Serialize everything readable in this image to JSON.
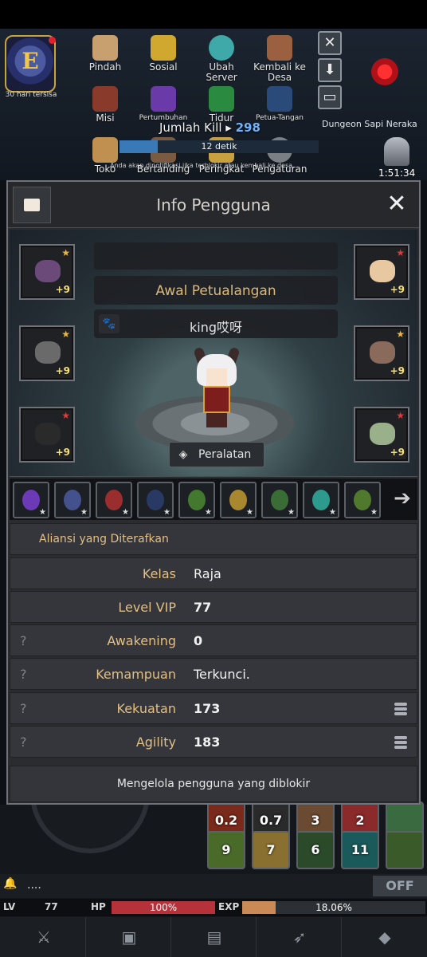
{
  "hud": {
    "guild_days": "30 hari tersisa",
    "guild_letter": "E",
    "menu": [
      {
        "label": "Pindah"
      },
      {
        "label": "Sosial"
      },
      {
        "label": "Ubah Server"
      },
      {
        "label": "Kembali ke Desa"
      },
      {
        "label": "Misi"
      },
      {
        "label": "Pertumbuhan"
      },
      {
        "label": "Tidur"
      },
      {
        "label": "Petua-Tangan"
      },
      {
        "label": "Toko"
      },
      {
        "label": "Bertanding"
      },
      {
        "label": "Peringkat"
      },
      {
        "label": "Pengaturan"
      }
    ],
    "kill_label": "Jumlah Kill",
    "kill_count": "298",
    "timer": "12 detik",
    "timer_progress": 0.19,
    "notice": "Anda akan dinotifikasi jika terblokir atau kembali ke desa.",
    "dungeon": "Dungeon Sapi Neraka",
    "clock": "1:51:34",
    "side_buttons": [
      "close-icon",
      "download-icon",
      "inbox-icon"
    ]
  },
  "modal": {
    "title": "Info Pengguna",
    "close_glyph": "✕",
    "player": {
      "title": "Awal Petualangan",
      "name": "king哎呀"
    },
    "equipment_button": "Peralatan",
    "equipment": {
      "left": [
        {
          "item": "shuriken-icon",
          "plus": "+9",
          "star_color": "#e6b84a",
          "color": "#6b4a7a"
        },
        {
          "item": "stone-icon",
          "plus": "+9",
          "star_color": "#e6b84a",
          "color": "#6a6a6a"
        },
        {
          "item": "dark-orb-icon",
          "plus": "+9",
          "star_color": "#d24040",
          "color": "#2a2a2a"
        }
      ],
      "right": [
        {
          "item": "bread-icon",
          "plus": "+9",
          "star_color": "#d24040",
          "color": "#e8c8a0"
        },
        {
          "item": "whetstone-icon",
          "plus": "+9",
          "star_color": "#e6b84a",
          "color": "#8a6a5a"
        },
        {
          "item": "ring-icon",
          "plus": "+9",
          "star_color": "#d24040",
          "color": "#9ab08a"
        }
      ]
    },
    "skills": [
      {
        "name": "shadow-strike-skill",
        "color": "#7a3fd0"
      },
      {
        "name": "shield-crest-skill",
        "color": "#4a5aa0"
      },
      {
        "name": "blood-heal-skill",
        "color": "#b03030"
      },
      {
        "name": "moonlight-skill",
        "color": "#2a3f70"
      },
      {
        "name": "nature-staff-skill",
        "color": "#4a8a30"
      },
      {
        "name": "golden-orb-skill",
        "color": "#c29a30"
      },
      {
        "name": "leaf-ring-skill",
        "color": "#3f7a3a"
      },
      {
        "name": "spirit-arrow-skill",
        "color": "#2fb0a0"
      },
      {
        "name": "stag-antler-skill",
        "color": "#5a8a30"
      }
    ],
    "alliance_label": "Aliansi yang Diterafkan",
    "stats": [
      {
        "key": "Kelas",
        "value": "Raja",
        "help": false,
        "detail": false,
        "bold": false
      },
      {
        "key": "Level VIP",
        "value": "77",
        "help": false,
        "detail": false,
        "bold": true
      },
      {
        "key": "Awakening",
        "value": "0",
        "help": true,
        "detail": false,
        "bold": true
      },
      {
        "key": "Kemampuan",
        "value": "Terkunci.",
        "help": true,
        "detail": false,
        "bold": false
      },
      {
        "key": "Kekuatan",
        "value": "173",
        "help": true,
        "detail": true,
        "bold": true
      },
      {
        "key": "Agility",
        "value": "183",
        "help": true,
        "detail": true,
        "bold": true
      }
    ],
    "help_glyph": "?",
    "blocked_button": "Mengelola pengguna yang diblokir"
  },
  "lower_hud": {
    "skill_numbers": [
      "0.2",
      "0.7",
      "3",
      "2",
      "9",
      "7",
      "6",
      "11"
    ],
    "chat_dots": "....",
    "off_label": "OFF",
    "lv_label": "LV",
    "lv_value": "77",
    "hp_label": "HP",
    "hp_value": "100%",
    "hp_fraction": 1.0,
    "exp_label": "EXP",
    "exp_value": "18.06%",
    "exp_fraction": 0.1806,
    "nav": [
      "sword-icon",
      "armor-icon",
      "scroll-icon",
      "pet-icon",
      "gem-icon"
    ]
  }
}
